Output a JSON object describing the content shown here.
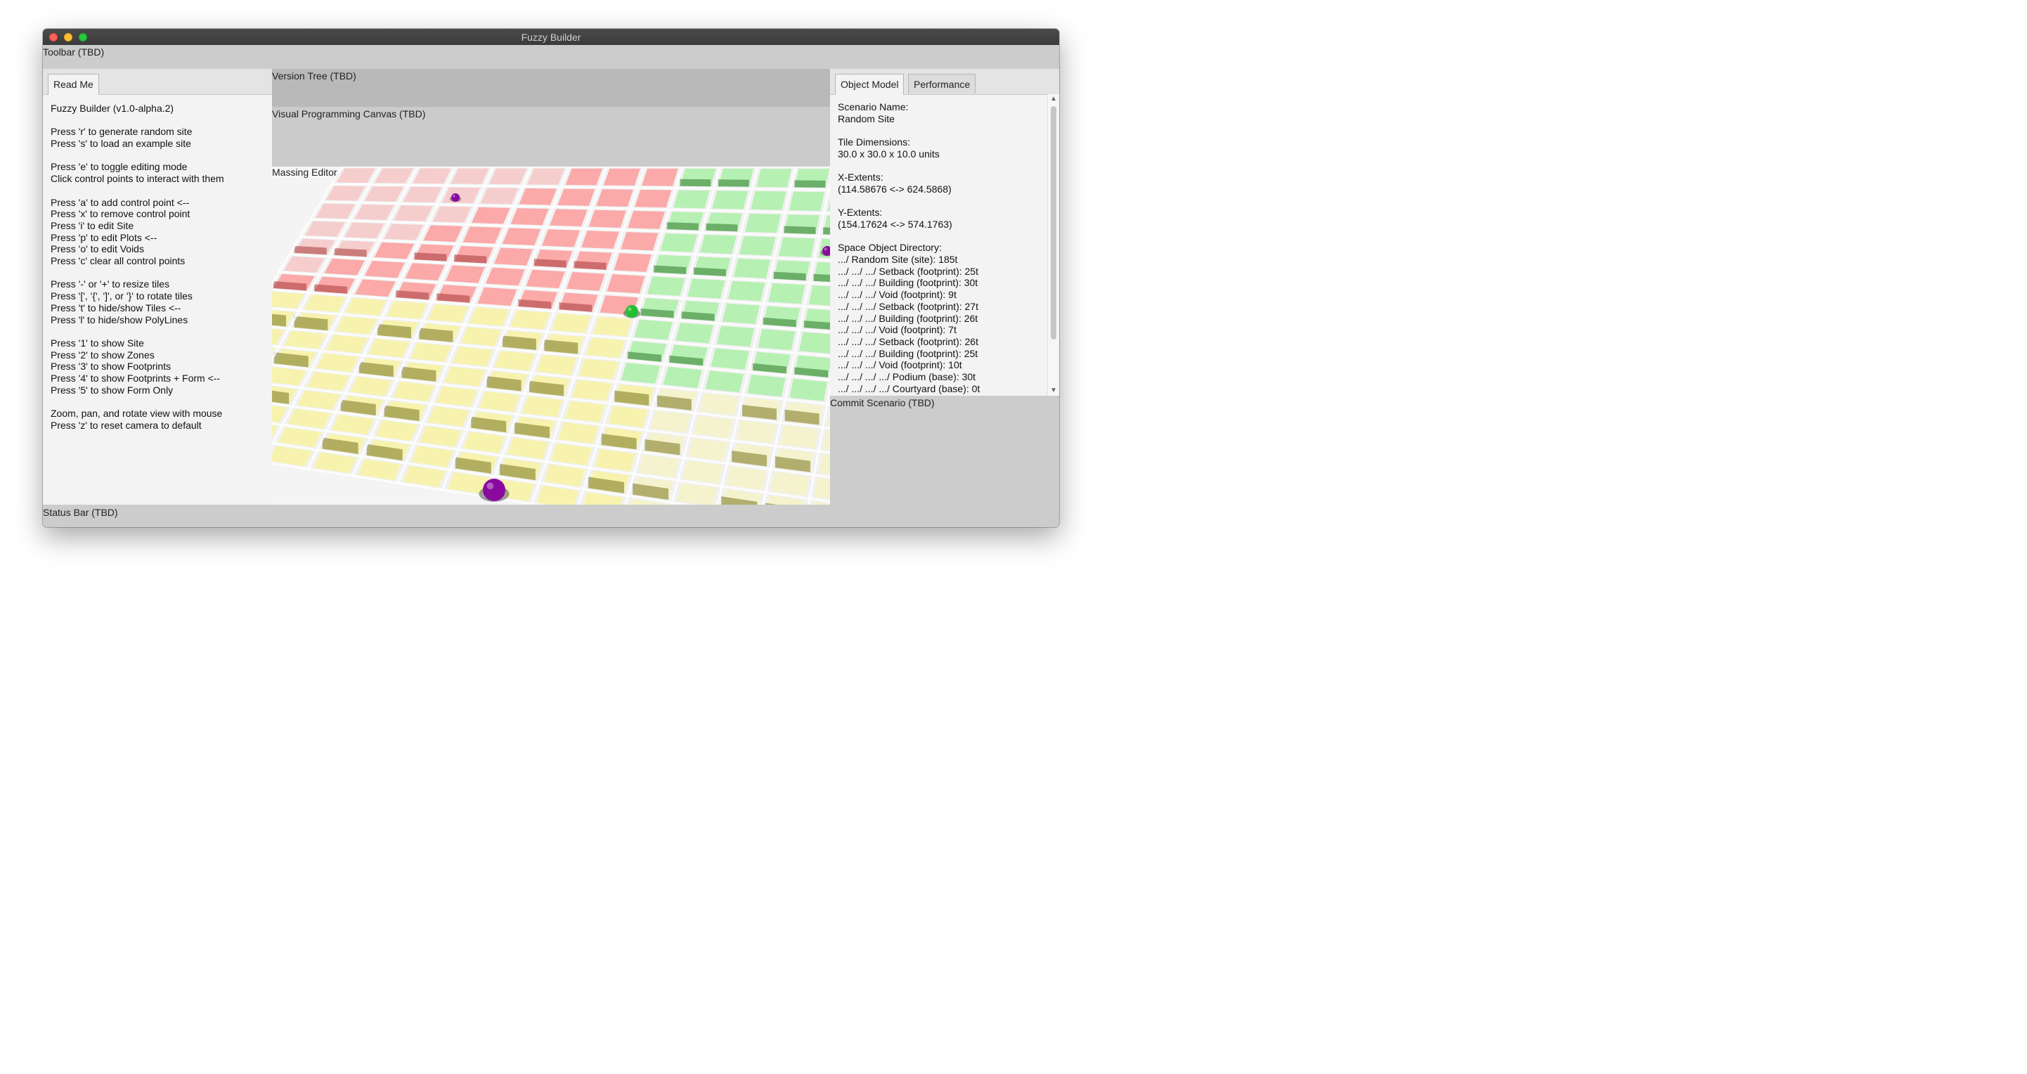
{
  "window": {
    "title": "Fuzzy Builder"
  },
  "regions": {
    "toolbar": "Toolbar (TBD)",
    "version_tree": "Version Tree (TBD)",
    "visual_programming": "Visual Programming Canvas (TBD)",
    "massing_editor": "Massing Editor",
    "commit": "Commit Scenario (TBD)",
    "status_bar": "Status Bar (TBD)"
  },
  "left_panel": {
    "tabs": [
      "Read Me"
    ],
    "readme": [
      "Fuzzy Builder (v1.0-alpha.2)",
      "",
      "Press 'r' to generate random site",
      "Press 's' to load an example site",
      "",
      "Press 'e' to toggle editing mode",
      "Click control points to interact with them",
      "",
      "Press 'a' to add control point <--",
      "Press 'x' to remove control point",
      "Press 'i' to edit Site",
      "Press 'p' to edit Plots <--",
      "Press 'o' to edit Voids",
      "Press 'c' clear all control points",
      "",
      "Press '-' or '+' to resize tiles",
      "Press '[', '{', ']', or '}' to rotate tiles",
      "Press 't' to hide/show Tiles <--",
      "Press 'l' to hide/show PolyLines",
      "",
      "Press '1' to show Site",
      "Press '2' to show Zones",
      "Press '3' to show Footprints",
      "Press '4' to show Footprints + Form <--",
      "Press '5' to show Form Only",
      "",
      "Zoom, pan, and rotate view with mouse",
      "Press 'z' to reset camera to default"
    ]
  },
  "right_panel": {
    "tabs": [
      "Object Model",
      "Performance"
    ],
    "object_model": [
      "Scenario Name:",
      "Random Site",
      "",
      "Tile Dimensions:",
      "30.0 x 30.0 x 10.0 units",
      "",
      "X-Extents:",
      "(114.58676 <-> 624.5868)",
      "",
      "Y-Extents:",
      "(154.17624 <-> 574.1763)",
      "",
      "Space Object Directory:",
      ".../ Random Site (site): 185t",
      ".../ .../ .../ Setback (footprint): 25t",
      ".../ .../ .../ Building (footprint): 30t",
      ".../ .../ .../ Void (footprint): 9t",
      ".../ .../ .../ Setback (footprint): 27t",
      ".../ .../ .../ Building (footprint): 26t",
      ".../ .../ .../ Void (footprint): 7t",
      ".../ .../ .../ Setback (footprint): 26t",
      ".../ .../ .../ Building (footprint): 25t",
      ".../ .../ .../ Void (footprint): 10t",
      ".../ .../ .../ .../ Podium (base): 30t",
      ".../ .../ .../ .../ Courtyard (base): 0t"
    ]
  },
  "zone_colors": {
    "red": "#ff8a8a",
    "green": "#8ff08a",
    "yellow": "#fbf58a",
    "control_point": "#8a0aa0",
    "green_point": "#22c030"
  }
}
